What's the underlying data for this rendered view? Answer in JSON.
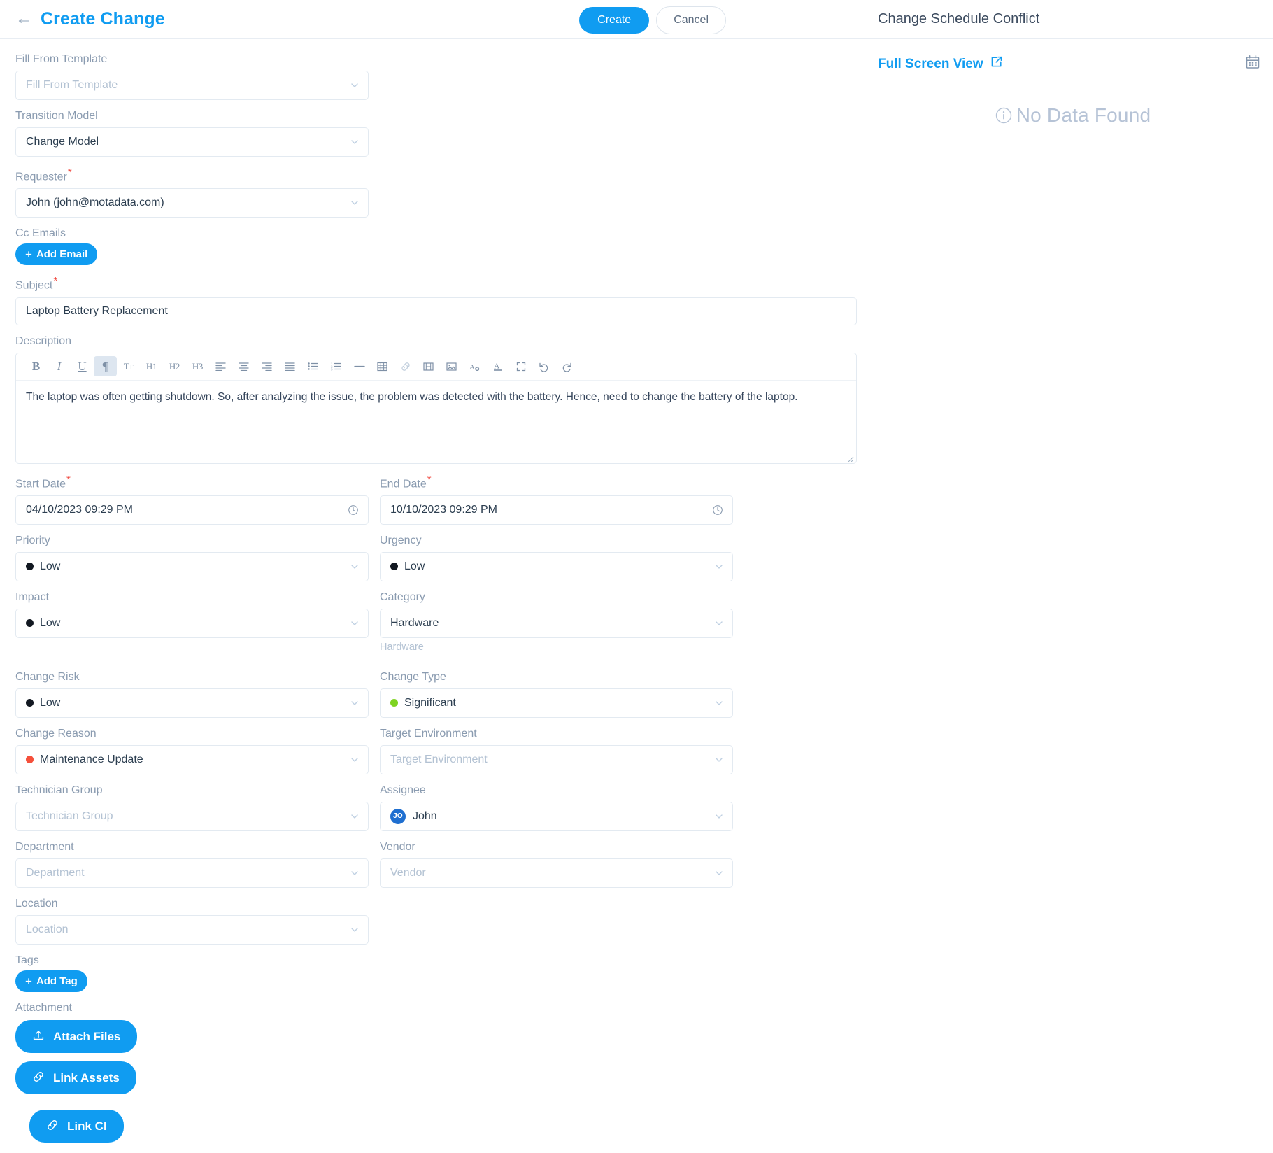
{
  "header": {
    "back_icon": "arrow-left-icon",
    "title": "Create Change",
    "create_label": "Create",
    "cancel_label": "Cancel"
  },
  "right_panel": {
    "title": "Change Schedule Conflict",
    "full_screen_label": "Full Screen View",
    "external_link_icon": "external-link-icon",
    "calendar_icon": "calendar-icon",
    "empty_state": "No Data Found",
    "info_icon": "info-circle-icon"
  },
  "form": {
    "fill_from_template": {
      "label": "Fill From Template",
      "value": "",
      "placeholder": "Fill From Template"
    },
    "transition_model": {
      "label": "Transition Model",
      "value": "Change Model"
    },
    "requester": {
      "label": "Requester",
      "required": "*",
      "value": "John (john@motadata.com)"
    },
    "cc_emails": {
      "label": "Cc Emails",
      "add_label": "Add Email"
    },
    "subject": {
      "label": "Subject",
      "required": "*",
      "value": "Laptop Battery Replacement",
      "placeholder": "Subject"
    },
    "description": {
      "label": "Description",
      "value": "The laptop was often getting shutdown. So, after analyzing the issue, the problem was detected with the battery. Hence, need to change the battery of the laptop.",
      "toolbar": [
        {
          "name": "bold-icon",
          "glyph": "B",
          "state": "normal"
        },
        {
          "name": "italic-icon",
          "glyph": "I",
          "state": "normal"
        },
        {
          "name": "underline-icon",
          "glyph": "U",
          "state": "normal"
        },
        {
          "name": "paragraph-icon",
          "glyph": "¶",
          "state": "active"
        },
        {
          "name": "font-size-icon",
          "glyph": "Tt",
          "state": "normal"
        },
        {
          "name": "heading-1-icon",
          "glyph": "H1",
          "state": "normal"
        },
        {
          "name": "heading-2-icon",
          "glyph": "H2",
          "state": "normal"
        },
        {
          "name": "heading-3-icon",
          "glyph": "H3",
          "state": "normal"
        },
        {
          "name": "align-left-icon",
          "glyph": "",
          "state": "normal"
        },
        {
          "name": "align-center-icon",
          "glyph": "",
          "state": "normal"
        },
        {
          "name": "align-right-icon",
          "glyph": "",
          "state": "normal"
        },
        {
          "name": "align-justify-icon",
          "glyph": "",
          "state": "normal"
        },
        {
          "name": "bullet-list-icon",
          "glyph": "",
          "state": "normal"
        },
        {
          "name": "numbered-list-icon",
          "glyph": "",
          "state": "normal"
        },
        {
          "name": "horizontal-rule-icon",
          "glyph": "—",
          "state": "normal"
        },
        {
          "name": "table-icon",
          "glyph": "",
          "state": "normal"
        },
        {
          "name": "link-icon",
          "glyph": "",
          "state": "disabled"
        },
        {
          "name": "video-icon",
          "glyph": "",
          "state": "normal"
        },
        {
          "name": "image-icon",
          "glyph": "",
          "state": "normal"
        },
        {
          "name": "clear-format-icon",
          "glyph": "",
          "state": "normal"
        },
        {
          "name": "text-color-icon",
          "glyph": "A",
          "state": "normal"
        },
        {
          "name": "fullscreen-icon",
          "glyph": "",
          "state": "normal"
        },
        {
          "name": "undo-icon",
          "glyph": "",
          "state": "normal"
        },
        {
          "name": "redo-icon",
          "glyph": "",
          "state": "normal"
        }
      ]
    },
    "start_date": {
      "label": "Start Date",
      "required": "*",
      "value": "04/10/2023 09:29 PM",
      "icon": "clock-icon"
    },
    "end_date": {
      "label": "End Date",
      "required": "*",
      "value": "10/10/2023 09:29 PM",
      "icon": "clock-icon"
    },
    "priority": {
      "label": "Priority",
      "value": "Low",
      "dot": "#121821"
    },
    "urgency": {
      "label": "Urgency",
      "value": "Low",
      "dot": "#121821"
    },
    "impact": {
      "label": "Impact",
      "value": "Low",
      "dot": "#121821"
    },
    "category": {
      "label": "Category",
      "value": "Hardware",
      "helper": "Hardware"
    },
    "change_risk": {
      "label": "Change Risk",
      "value": "Low",
      "dot": "#121821"
    },
    "change_type": {
      "label": "Change Type",
      "value": "Significant",
      "dot": "#7ED321"
    },
    "change_reason": {
      "label": "Change Reason",
      "value": "Maintenance Update",
      "dot": "#F5503B"
    },
    "target_environment": {
      "label": "Target Environment",
      "value": "",
      "placeholder": "Target Environment"
    },
    "technician_group": {
      "label": "Technician Group",
      "value": "",
      "placeholder": "Technician Group"
    },
    "assignee": {
      "label": "Assignee",
      "value": "John",
      "avatar_initials": "JO"
    },
    "department": {
      "label": "Department",
      "value": "",
      "placeholder": "Department"
    },
    "vendor": {
      "label": "Vendor",
      "value": "",
      "placeholder": "Vendor"
    },
    "location": {
      "label": "Location",
      "value": "",
      "placeholder": "Location"
    },
    "tags": {
      "label": "Tags",
      "add_label": "Add Tag"
    },
    "attachment": {
      "label": "Attachment",
      "attach_files_label": "Attach Files",
      "attach_icon": "upload-icon",
      "link_assets_label": "Link Assets",
      "link_assets_icon": "link-icon",
      "link_ci_label": "Link CI",
      "link_ci_icon": "link-icon"
    }
  },
  "colors": {
    "accent": "#109CF1",
    "label": "#8a9bb0",
    "required": "#f0473e",
    "border": "#e3eaf1"
  }
}
